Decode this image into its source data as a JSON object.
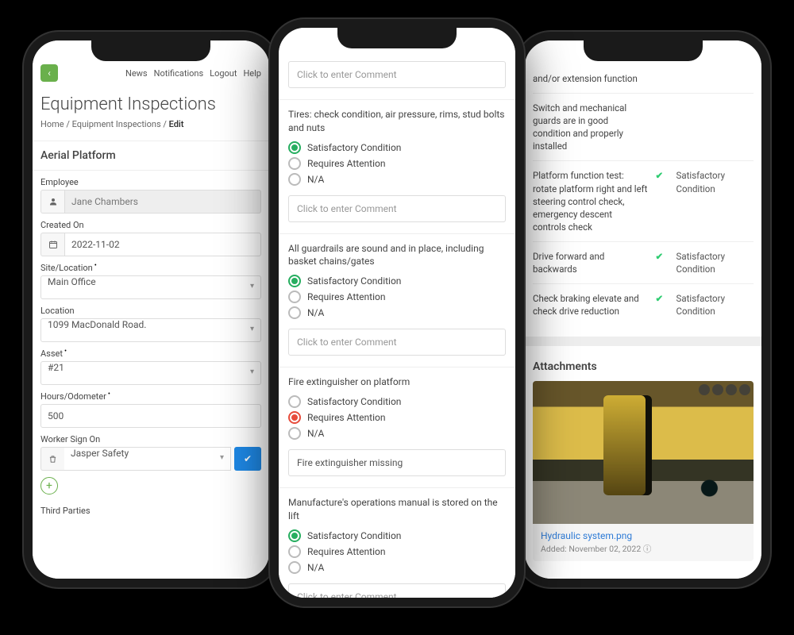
{
  "phone1": {
    "nav": {
      "news": "News",
      "notifications": "Notifications",
      "logout": "Logout",
      "help": "Help"
    },
    "back_icon": "‹",
    "title": "Equipment Inspections",
    "breadcrumb": {
      "home": "Home",
      "sep": " / ",
      "section": "Equipment Inspections",
      "current": "Edit"
    },
    "section": "Aerial Platform",
    "fields": {
      "employee_label": "Employee",
      "employee_value": "Jane Chambers",
      "created_label": "Created On",
      "created_value": "2022-11-02",
      "site_label": "Site/Location",
      "site_value": "Main Office",
      "location_label": "Location",
      "location_value": "1099 MacDonald Road.",
      "asset_label": "Asset",
      "asset_value": "#21",
      "hours_label": "Hours/Odometer",
      "hours_value": "500",
      "worker_label": "Worker Sign On",
      "worker_value": "Jasper Safety",
      "third_parties_label": "Third Parties"
    },
    "plus": "+",
    "check": "✔"
  },
  "phone2": {
    "placeholder": "Click to enter Comment",
    "options": {
      "sat": "Satisfactory Condition",
      "att": "Requires Attention",
      "na": "N/A"
    },
    "q_tires": "Tires: check condition, air pressure, rims, stud bolts and nuts",
    "q_guards": "All guardrails are sound and in place, including basket chains/gates",
    "q_fire": "Fire extinguisher on platform",
    "fire_comment": "Fire extinguisher missing",
    "q_manual": "Manufacture's operations manual is stored on the lift"
  },
  "phone3": {
    "rows": [
      {
        "label": "and/or extension function",
        "status": ""
      },
      {
        "label": "Switch and mechanical guards are in good condition and properly installed",
        "status": ""
      },
      {
        "label": "Platform function test: rotate platform right and left steering control check, emergency descent controls check",
        "status": "Satisfactory Condition"
      },
      {
        "label": "Drive forward and backwards",
        "status": "Satisfactory Condition"
      },
      {
        "label": "Check braking elevate and check drive reduction",
        "status": "Satisfactory Condition"
      }
    ],
    "attach_title": "Attachments",
    "attach_name": "Hydraulic system.png",
    "attach_date": "Added: November 02, 2022 ⓘ",
    "check": "✔"
  }
}
